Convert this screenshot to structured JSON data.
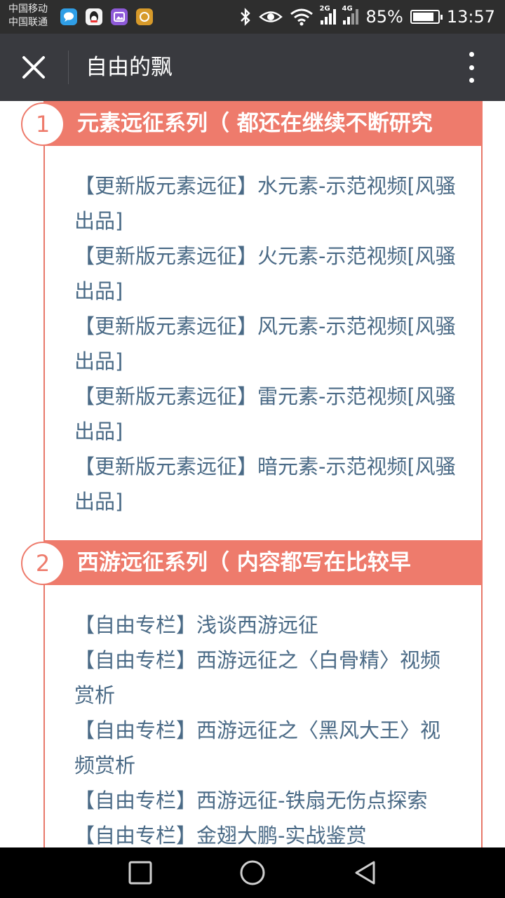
{
  "status_bar": {
    "carrier_1": "中国移动",
    "carrier_2": "中国联通",
    "network_1": "2G",
    "network_2": "4G",
    "battery_text": "85%",
    "battery_level": 0.85,
    "time": "13:57"
  },
  "title_bar": {
    "title": "自由的飘"
  },
  "sections": [
    {
      "number": "1",
      "title": "元素远征系列（ 都还在继续不断研究",
      "items": [
        "【更新版元素远征】水元素-示范视频[风骚出品]",
        "【更新版元素远征】火元素-示范视频[风骚出品]",
        "【更新版元素远征】风元素-示范视频[风骚出品]",
        "【更新版元素远征】雷元素-示范视频[风骚出品]",
        "【更新版元素远征】暗元素-示范视频[风骚出品]"
      ]
    },
    {
      "number": "2",
      "title": "西游远征系列（ 内容都写在比较早",
      "items": [
        "【自由专栏】浅谈西游远征",
        "【自由专栏】西游远征之〈白骨精〉视频赏析",
        "【自由专栏】西游远征之〈黑风大王〉视频赏析",
        "【自由专栏】西游远征-铁扇无伤点探索",
        "【自由专栏】金翅大鹏-实战鉴赏"
      ]
    }
  ],
  "colors": {
    "accent": "#ee7b6c",
    "link": "#4a6a86",
    "title_bar": "#393a3f",
    "status_bar": "#2e2e2e"
  }
}
